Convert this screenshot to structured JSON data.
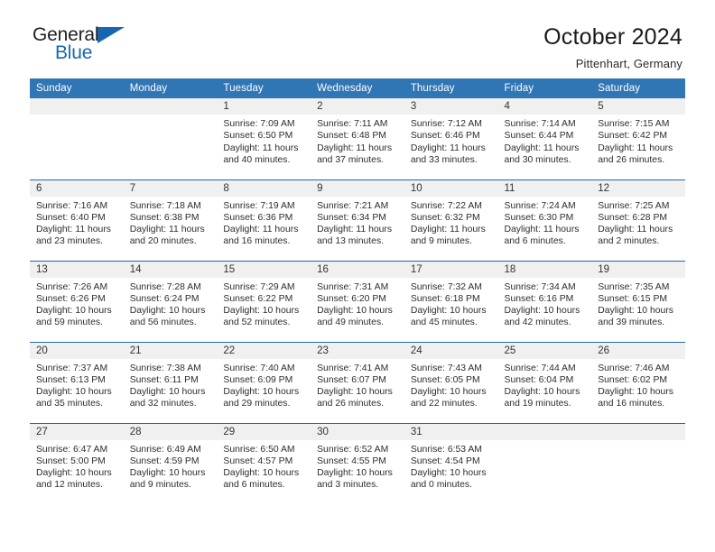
{
  "brand": {
    "name_part1": "General",
    "name_part2": "Blue",
    "accent_color": "#1667b0"
  },
  "header": {
    "title": "October 2024",
    "subtitle": "Pittenhart, Germany"
  },
  "calendar": {
    "header_bg": "#3075b4",
    "row_divider_color": "#1f69ad",
    "daynum_bg": "#f0f0f0",
    "weekdays": [
      "Sunday",
      "Monday",
      "Tuesday",
      "Wednesday",
      "Thursday",
      "Friday",
      "Saturday"
    ],
    "weeks": [
      [
        {
          "day": "",
          "lines": []
        },
        {
          "day": "",
          "lines": []
        },
        {
          "day": "1",
          "lines": [
            "Sunrise: 7:09 AM",
            "Sunset: 6:50 PM",
            "Daylight: 11 hours",
            "and 40 minutes."
          ]
        },
        {
          "day": "2",
          "lines": [
            "Sunrise: 7:11 AM",
            "Sunset: 6:48 PM",
            "Daylight: 11 hours",
            "and 37 minutes."
          ]
        },
        {
          "day": "3",
          "lines": [
            "Sunrise: 7:12 AM",
            "Sunset: 6:46 PM",
            "Daylight: 11 hours",
            "and 33 minutes."
          ]
        },
        {
          "day": "4",
          "lines": [
            "Sunrise: 7:14 AM",
            "Sunset: 6:44 PM",
            "Daylight: 11 hours",
            "and 30 minutes."
          ]
        },
        {
          "day": "5",
          "lines": [
            "Sunrise: 7:15 AM",
            "Sunset: 6:42 PM",
            "Daylight: 11 hours",
            "and 26 minutes."
          ]
        }
      ],
      [
        {
          "day": "6",
          "lines": [
            "Sunrise: 7:16 AM",
            "Sunset: 6:40 PM",
            "Daylight: 11 hours",
            "and 23 minutes."
          ]
        },
        {
          "day": "7",
          "lines": [
            "Sunrise: 7:18 AM",
            "Sunset: 6:38 PM",
            "Daylight: 11 hours",
            "and 20 minutes."
          ]
        },
        {
          "day": "8",
          "lines": [
            "Sunrise: 7:19 AM",
            "Sunset: 6:36 PM",
            "Daylight: 11 hours",
            "and 16 minutes."
          ]
        },
        {
          "day": "9",
          "lines": [
            "Sunrise: 7:21 AM",
            "Sunset: 6:34 PM",
            "Daylight: 11 hours",
            "and 13 minutes."
          ]
        },
        {
          "day": "10",
          "lines": [
            "Sunrise: 7:22 AM",
            "Sunset: 6:32 PM",
            "Daylight: 11 hours",
            "and 9 minutes."
          ]
        },
        {
          "day": "11",
          "lines": [
            "Sunrise: 7:24 AM",
            "Sunset: 6:30 PM",
            "Daylight: 11 hours",
            "and 6 minutes."
          ]
        },
        {
          "day": "12",
          "lines": [
            "Sunrise: 7:25 AM",
            "Sunset: 6:28 PM",
            "Daylight: 11 hours",
            "and 2 minutes."
          ]
        }
      ],
      [
        {
          "day": "13",
          "lines": [
            "Sunrise: 7:26 AM",
            "Sunset: 6:26 PM",
            "Daylight: 10 hours",
            "and 59 minutes."
          ]
        },
        {
          "day": "14",
          "lines": [
            "Sunrise: 7:28 AM",
            "Sunset: 6:24 PM",
            "Daylight: 10 hours",
            "and 56 minutes."
          ]
        },
        {
          "day": "15",
          "lines": [
            "Sunrise: 7:29 AM",
            "Sunset: 6:22 PM",
            "Daylight: 10 hours",
            "and 52 minutes."
          ]
        },
        {
          "day": "16",
          "lines": [
            "Sunrise: 7:31 AM",
            "Sunset: 6:20 PM",
            "Daylight: 10 hours",
            "and 49 minutes."
          ]
        },
        {
          "day": "17",
          "lines": [
            "Sunrise: 7:32 AM",
            "Sunset: 6:18 PM",
            "Daylight: 10 hours",
            "and 45 minutes."
          ]
        },
        {
          "day": "18",
          "lines": [
            "Sunrise: 7:34 AM",
            "Sunset: 6:16 PM",
            "Daylight: 10 hours",
            "and 42 minutes."
          ]
        },
        {
          "day": "19",
          "lines": [
            "Sunrise: 7:35 AM",
            "Sunset: 6:15 PM",
            "Daylight: 10 hours",
            "and 39 minutes."
          ]
        }
      ],
      [
        {
          "day": "20",
          "lines": [
            "Sunrise: 7:37 AM",
            "Sunset: 6:13 PM",
            "Daylight: 10 hours",
            "and 35 minutes."
          ]
        },
        {
          "day": "21",
          "lines": [
            "Sunrise: 7:38 AM",
            "Sunset: 6:11 PM",
            "Daylight: 10 hours",
            "and 32 minutes."
          ]
        },
        {
          "day": "22",
          "lines": [
            "Sunrise: 7:40 AM",
            "Sunset: 6:09 PM",
            "Daylight: 10 hours",
            "and 29 minutes."
          ]
        },
        {
          "day": "23",
          "lines": [
            "Sunrise: 7:41 AM",
            "Sunset: 6:07 PM",
            "Daylight: 10 hours",
            "and 26 minutes."
          ]
        },
        {
          "day": "24",
          "lines": [
            "Sunrise: 7:43 AM",
            "Sunset: 6:05 PM",
            "Daylight: 10 hours",
            "and 22 minutes."
          ]
        },
        {
          "day": "25",
          "lines": [
            "Sunrise: 7:44 AM",
            "Sunset: 6:04 PM",
            "Daylight: 10 hours",
            "and 19 minutes."
          ]
        },
        {
          "day": "26",
          "lines": [
            "Sunrise: 7:46 AM",
            "Sunset: 6:02 PM",
            "Daylight: 10 hours",
            "and 16 minutes."
          ]
        }
      ],
      [
        {
          "day": "27",
          "lines": [
            "Sunrise: 6:47 AM",
            "Sunset: 5:00 PM",
            "Daylight: 10 hours",
            "and 12 minutes."
          ]
        },
        {
          "day": "28",
          "lines": [
            "Sunrise: 6:49 AM",
            "Sunset: 4:59 PM",
            "Daylight: 10 hours",
            "and 9 minutes."
          ]
        },
        {
          "day": "29",
          "lines": [
            "Sunrise: 6:50 AM",
            "Sunset: 4:57 PM",
            "Daylight: 10 hours",
            "and 6 minutes."
          ]
        },
        {
          "day": "30",
          "lines": [
            "Sunrise: 6:52 AM",
            "Sunset: 4:55 PM",
            "Daylight: 10 hours",
            "and 3 minutes."
          ]
        },
        {
          "day": "31",
          "lines": [
            "Sunrise: 6:53 AM",
            "Sunset: 4:54 PM",
            "Daylight: 10 hours",
            "and 0 minutes."
          ]
        },
        {
          "day": "",
          "lines": []
        },
        {
          "day": "",
          "lines": []
        }
      ]
    ]
  }
}
